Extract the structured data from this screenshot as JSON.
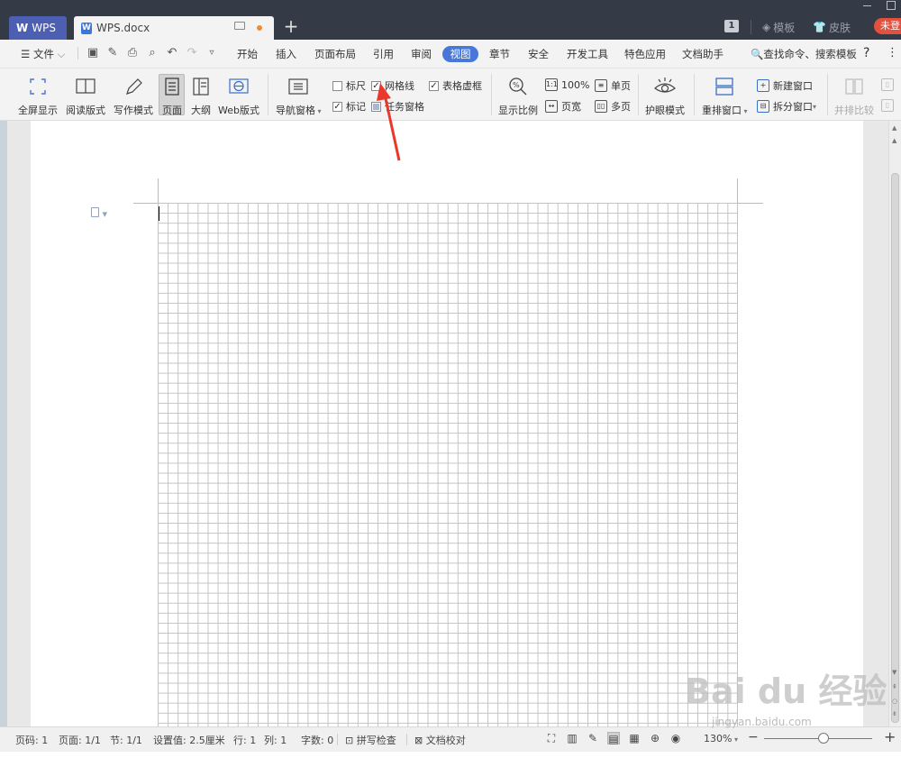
{
  "titlebar": {
    "app_tab": "WPS",
    "doc_tab": "WPS.docx",
    "new_tab": "+",
    "badge": "1",
    "template": "模板",
    "skin": "皮肤",
    "login": "未登"
  },
  "menu": {
    "file": "文件",
    "items": [
      "开始",
      "插入",
      "页面布局",
      "引用",
      "审阅",
      "视图",
      "章节",
      "安全",
      "开发工具",
      "特色应用",
      "文档助手"
    ],
    "active": "视图",
    "search": "查找命令、搜索模板",
    "help": "?",
    "more": "⋮"
  },
  "ribbon": {
    "fullscreen": "全屏显示",
    "reading": "阅读版式",
    "writing": "写作模式",
    "page": "页面",
    "outline": "大纲",
    "web": "Web版式",
    "nav_pane": "导航窗格",
    "ruler": "标尺",
    "gridlines": "网格线",
    "table_gridlines": "表格虚框",
    "markup": "标记",
    "task_pane": "任务窗格",
    "zoom_ratio": "显示比例",
    "zoom_100": "100%",
    "page_width": "页宽",
    "one_page": "单页",
    "multi_page": "多页",
    "eye_mode": "护眼模式",
    "arrange": "重排窗口",
    "new_window": "新建窗口",
    "split_window": "拆分窗口",
    "side_by_side": "并排比较",
    "checks": {
      "ruler": false,
      "gridlines": true,
      "table_gridlines": true,
      "markup": true,
      "task_pane": false
    }
  },
  "status": {
    "page_no": "页码: 1",
    "pages": "页面: 1/1",
    "section": "节: 1/1",
    "setting": "设置值: 2.5厘米",
    "row": "行: 1",
    "col": "列: 1",
    "words": "字数: 0",
    "spell": "拼写检查",
    "proof": "文档校对",
    "zoom": "130%",
    "zoom_minus": "−",
    "zoom_plus": "+"
  },
  "watermark": {
    "main": "Bai du 经验",
    "sub": "jingyan.baidu.com"
  },
  "colors": {
    "titlebar": "#343a46",
    "accent": "#4778d9",
    "login": "#e2503e",
    "arrow": "#e8392a"
  }
}
